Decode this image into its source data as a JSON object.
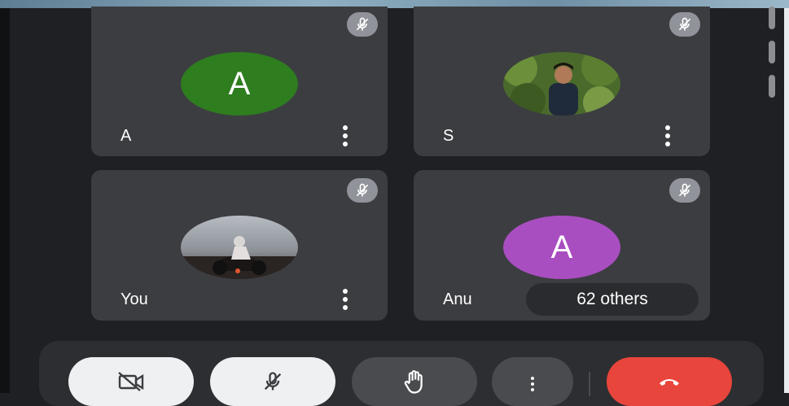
{
  "participants": [
    {
      "name": "A",
      "avatar_letter": "A",
      "avatar_type": "letter",
      "avatar_color": "#2e7d1f",
      "muted": true
    },
    {
      "name": "S",
      "avatar_letter": "",
      "avatar_type": "photo",
      "muted": true
    },
    {
      "name": "You",
      "avatar_letter": "",
      "avatar_type": "photo",
      "muted": true
    },
    {
      "name": "Anu",
      "avatar_letter": "A",
      "avatar_type": "letter",
      "avatar_color": "#a94ec0",
      "muted": true
    }
  ],
  "others_label": "62 others",
  "controls": {
    "camera_icon": "video-off-icon",
    "mic_icon": "mic-off-icon",
    "hand_icon": "raise-hand-icon",
    "more_icon": "more-vert-icon",
    "end_icon": "call-end-icon"
  },
  "colors": {
    "tile_bg": "#3c3d41",
    "end_call": "#e8453c",
    "control_light": "#eef0f2",
    "control_dark": "#4a4b4f"
  }
}
